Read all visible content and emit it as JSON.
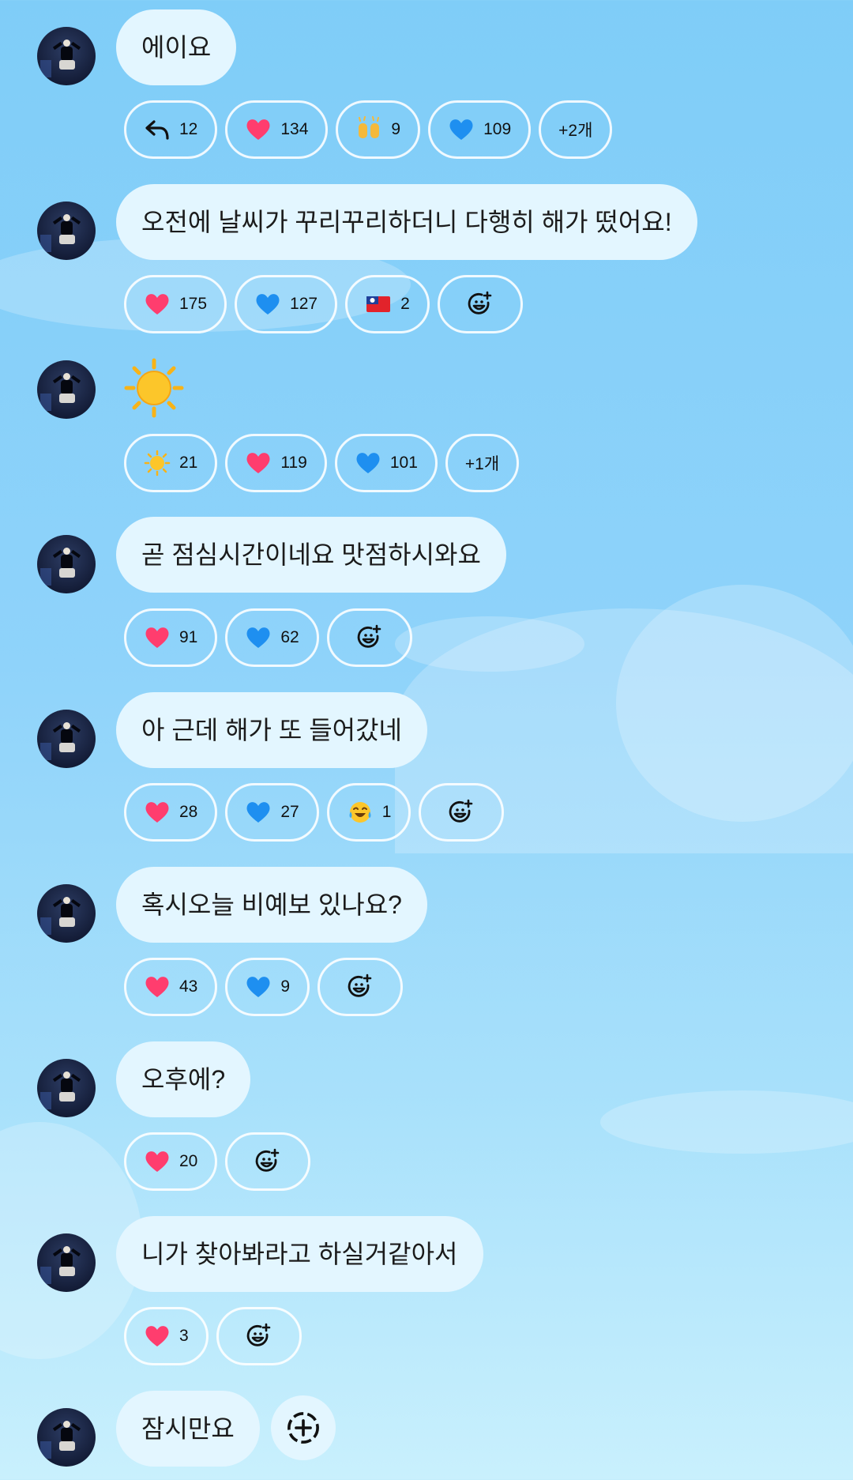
{
  "messages": [
    {
      "text": "에이요",
      "reactions": [
        {
          "icon": "reply-icon",
          "count": "12"
        },
        {
          "icon": "red-heart-icon",
          "count": "134"
        },
        {
          "icon": "raised-hands-icon",
          "count": "9"
        },
        {
          "icon": "blue-heart-icon",
          "count": "109"
        },
        {
          "more": "+2개"
        }
      ]
    },
    {
      "text": "오전에 날씨가 꾸리꾸리하더니 다행히 해가 떴어요!",
      "reactions": [
        {
          "icon": "red-heart-icon",
          "count": "175"
        },
        {
          "icon": "blue-heart-icon",
          "count": "127"
        },
        {
          "icon": "taiwan-flag-icon",
          "count": "2"
        }
      ]
    },
    {
      "emoji": "sun-icon",
      "reactions": [
        {
          "icon": "sun-icon",
          "count": "21"
        },
        {
          "icon": "red-heart-icon",
          "count": "119"
        },
        {
          "icon": "blue-heart-icon",
          "count": "101"
        },
        {
          "more": "+1개"
        }
      ]
    },
    {
      "text": "곧 점심시간이네요 맛점하시와요",
      "reactions": [
        {
          "icon": "red-heart-icon",
          "count": "91"
        },
        {
          "icon": "blue-heart-icon",
          "count": "62"
        }
      ]
    },
    {
      "text": "아 근데 해가 또 들어갔네",
      "reactions": [
        {
          "icon": "red-heart-icon",
          "count": "28"
        },
        {
          "icon": "blue-heart-icon",
          "count": "27"
        },
        {
          "icon": "tears-of-joy-icon",
          "count": "1"
        }
      ]
    },
    {
      "text": "혹시오늘 비예보 있나요?",
      "reactions": [
        {
          "icon": "red-heart-icon",
          "count": "43"
        },
        {
          "icon": "blue-heart-icon",
          "count": "9"
        }
      ]
    },
    {
      "text": "오후에?",
      "reactions": [
        {
          "icon": "red-heart-icon",
          "count": "20"
        }
      ]
    },
    {
      "text": "니가 찾아봐라고 하실거같아서",
      "reactions": [
        {
          "icon": "red-heart-icon",
          "count": "3"
        }
      ]
    },
    {
      "text": "잠시만요"
    }
  ],
  "colors": {
    "bubble": "#e3f6ff",
    "heart_red": "#ff3d6e",
    "heart_blue": "#1e8ff0",
    "sky": "#8fd3fa"
  }
}
